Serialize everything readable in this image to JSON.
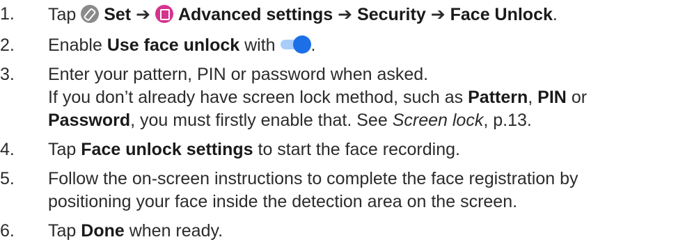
{
  "steps": [
    {
      "number": "1.",
      "tap": "Tap",
      "set_icon": "wrench-icon",
      "set": "Set",
      "arrow": "➔",
      "advanced_icon": "advanced-settings-icon",
      "advanced": "Advanced settings",
      "security": "Security",
      "face_unlock": "Face Unlock",
      "period": "."
    },
    {
      "number": "2.",
      "enable": "Enable",
      "use_face_unlock": "Use face unlock",
      "with": "with",
      "toggle_state": "on",
      "toggle_color": "#1d6fe8",
      "period": "."
    },
    {
      "number": "3.",
      "line1": "Enter your pattern, PIN or password when asked.",
      "line2": "If you don’t already have screen lock method, such as",
      "pattern": "Pattern",
      "comma": ",",
      "pin": "PIN",
      "or": "or",
      "password": "Password",
      "line3_rest": ", you must firstly enable that. See",
      "screen_lock": "Screen lock",
      "page_ref": ", p.13."
    },
    {
      "number": "4.",
      "tap": "Tap",
      "face_unlock_settings": "Face unlock settings",
      "rest": "to start the face recording."
    },
    {
      "number": "5.",
      "line1": "Follow the on-screen instructions to complete the face registration by",
      "line2": "positioning your face inside the detection area on the screen."
    },
    {
      "number": "6.",
      "tap": "Tap",
      "done": "Done",
      "rest": "when ready."
    }
  ]
}
